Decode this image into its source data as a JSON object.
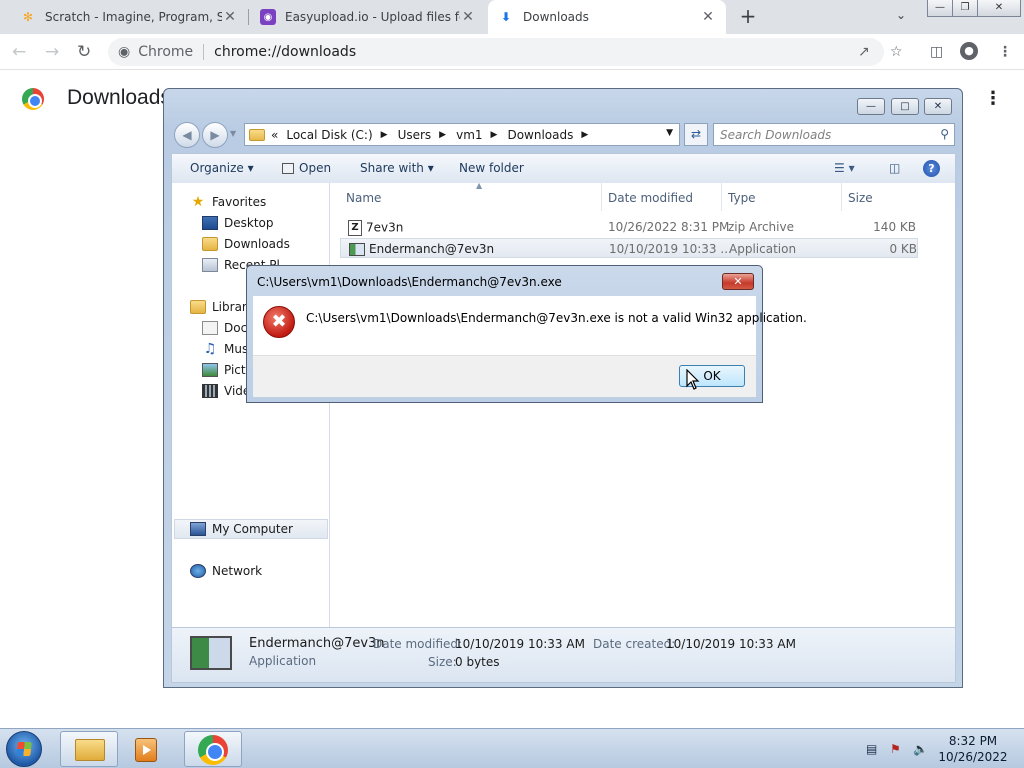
{
  "browser": {
    "tabs": [
      {
        "title": "Scratch - Imagine, Program, Share",
        "icon": "scratch-icon",
        "active": false
      },
      {
        "title": "Easyupload.io - Upload files for free",
        "icon": "easyupload-icon",
        "active": false
      },
      {
        "title": "Downloads",
        "icon": "download-icon",
        "active": true
      }
    ],
    "new_tab_label": "+",
    "omnibox": {
      "site_label": "Chrome",
      "url": "chrome://downloads"
    },
    "page_title": "Downloads"
  },
  "explorer": {
    "breadcrumbs": [
      "Local Disk (C:)",
      "Users",
      "vm1",
      "Downloads"
    ],
    "breadcrumb_prefix": "«",
    "search_placeholder": "Search Downloads",
    "commands": {
      "organize": "Organize",
      "open": "Open",
      "share_with": "Share with",
      "new_folder": "New folder"
    },
    "nav": {
      "favorites": "Favorites",
      "desktop": "Desktop",
      "downloads": "Downloads",
      "recent": "Recent Pl",
      "libraries": "Librari",
      "documents": "Docu",
      "music": "Musi",
      "pictures": "Pictu",
      "videos": "Vide",
      "my_computer": "My Computer",
      "network": "Network"
    },
    "columns": {
      "name": "Name",
      "date": "Date modified",
      "type": "Type",
      "size": "Size"
    },
    "files": [
      {
        "name": "7ev3n",
        "date": "10/26/2022 8:31 PM",
        "type": "zip Archive",
        "size": "140 KB"
      },
      {
        "name": "Endermanch@7ev3n",
        "date": "10/10/2019 10:33 ...",
        "type": "Application",
        "size": "0 KB"
      }
    ],
    "details": {
      "name": "Endermanch@7ev3n",
      "kind": "Application",
      "date_modified_label": "Date modified:",
      "date_modified": "10/10/2019 10:33 AM",
      "date_created_label": "Date created:",
      "date_created": "10/10/2019 10:33 AM",
      "size_label": "Size:",
      "size": "0 bytes"
    }
  },
  "dialog": {
    "title": "C:\\Users\\vm1\\Downloads\\Endermanch@7ev3n.exe",
    "message": "C:\\Users\\vm1\\Downloads\\Endermanch@7ev3n.exe is not a valid Win32 application.",
    "ok_label": "OK",
    "close_label": "✕"
  },
  "taskbar": {
    "time": "8:32 PM",
    "date": "10/26/2022"
  },
  "colors": {
    "chrome_tabstrip": "#dee1e6",
    "explorer_frame": "#b9cce3",
    "error_red": "#c11b12",
    "taskbar": "#b6c9e0"
  }
}
